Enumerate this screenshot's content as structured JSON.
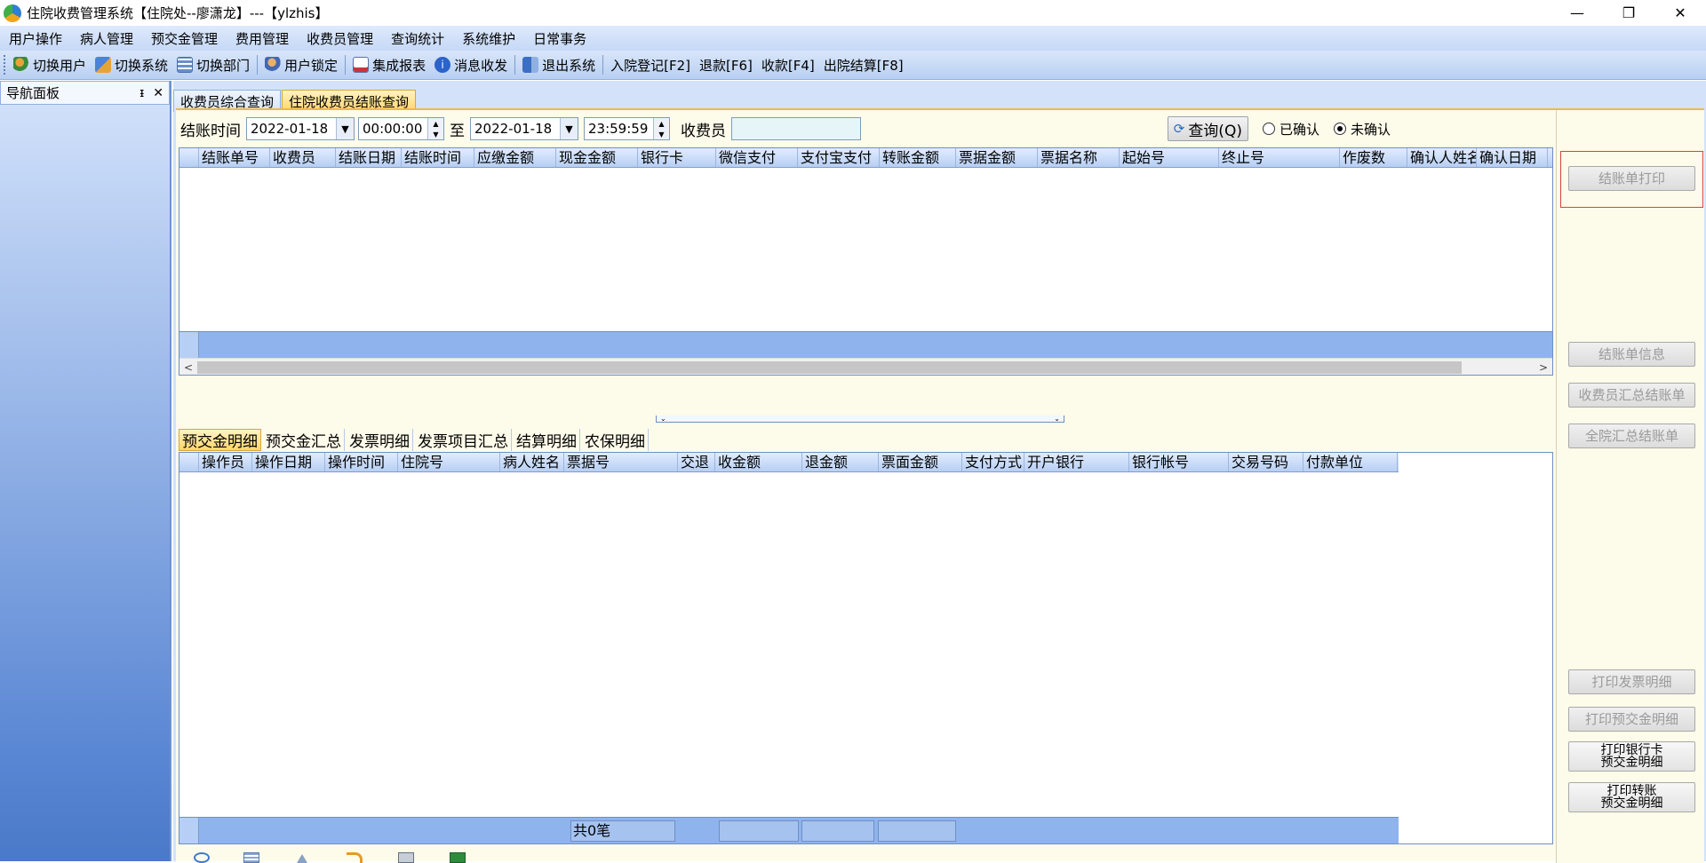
{
  "window": {
    "title": "住院收费管理系统【住院处--廖潇龙】---【ylzhis】",
    "controls": [
      "—",
      "❐",
      "✕"
    ]
  },
  "menu": [
    "用户操作",
    "病人管理",
    "预交金管理",
    "费用管理",
    "收费员管理",
    "查询统计",
    "系统维护",
    "日常事务"
  ],
  "toolbar": {
    "switch_user": "切换用户",
    "switch_system": "切换系统",
    "switch_dept": "切换部门",
    "user_lock": "用户锁定",
    "report": "集成报表",
    "messages": "消息收发",
    "exit": "退出系统",
    "admit": "入院登记[F2]",
    "refund": "退款[F6]",
    "collect": "收款[F4]",
    "discharge": "出院结算[F8]"
  },
  "nav": {
    "title": "导航面板",
    "pin": "ᵻ",
    "close": "✕"
  },
  "tabs": [
    "收费员综合查询",
    "住院收费员结账查询"
  ],
  "filter": {
    "label": "结账时间",
    "from_date": "2022-01-18",
    "from_time": "00:00:00",
    "to_label": "至",
    "to_date": "2022-01-18",
    "to_time": "23:59:59",
    "cashier_label": "收费员",
    "query_button": "查询(Q)",
    "radio_confirmed": "已确认",
    "radio_unconfirmed": "未确认",
    "selected_radio": "未确认"
  },
  "top_grid": {
    "columns": [
      "结账单号",
      "收费员",
      "结账日期",
      "结账时间",
      "应缴金额",
      "现金金额",
      "银行卡",
      "微信支付",
      "支付宝支付",
      "转账金额",
      "票据金额",
      "票据名称",
      "起始号",
      "终止号",
      "作废数",
      "确认人姓名",
      "确认日期"
    ]
  },
  "sub_tabs": [
    "预交金明细",
    "预交金汇总",
    "发票明细",
    "发票项目汇总",
    "结算明细",
    "农保明细"
  ],
  "bottom_grid": {
    "columns": [
      "操作员",
      "操作日期",
      "操作时间",
      "住院号",
      "病人姓名",
      "票据号",
      "交退",
      "收金额",
      "退金额",
      "票面金额",
      "支付方式",
      "开户银行",
      "银行帐号",
      "交易号码",
      "付款单位"
    ],
    "footer_count": "共0笔"
  },
  "right_panel": {
    "print_statement": "结账单打印",
    "statement_info": "结账单信息",
    "cashier_summary": "收费员汇总结账单",
    "hospital_summary": "全院汇总结账单",
    "print_invoice_detail": "打印发票明细",
    "print_deposit_detail": "打印预交金明细",
    "print_bankcard_1": "打印银行卡",
    "print_bankcard_2": "预交金明细",
    "print_transfer_1": "打印转账",
    "print_transfer_2": "预交金明细"
  }
}
